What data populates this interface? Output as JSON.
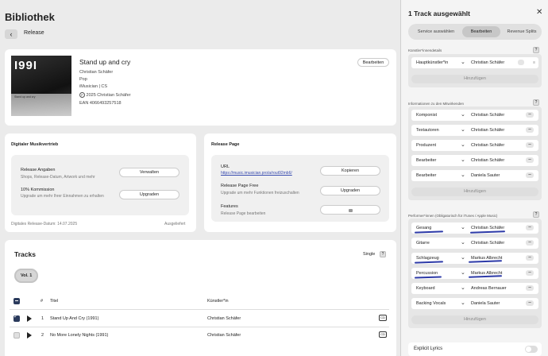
{
  "page": {
    "title": "Bibliothek",
    "breadcrumb": "Release"
  },
  "release": {
    "cover_text": "I99I",
    "cover_caption": "Stand up and cry",
    "name": "Stand up and cry",
    "artist": "Christian Schäfer",
    "genre": "Pop",
    "label_line": "iMusician | CS",
    "copyright": "2025 Christian Schäfer",
    "ean": "EAN 4066493257518",
    "edit_button": "Bearbeiten"
  },
  "distribution": {
    "title": "Digitaler Musikvertrieb",
    "release_info_title": "Release Angaben",
    "release_info_sub": "Shops, Release-Datum, Artwork und mehr",
    "manage_button": "Verwalten",
    "commission_title": "10% Kommission",
    "commission_sub": "Upgrade um mehr Ihrer Einnahmen zu erhalten",
    "upgrade_button": "Upgraden",
    "date_label": "Digitales Release-Datum: 14.07.2025",
    "status": "Ausgeliefert"
  },
  "release_page": {
    "title": "Release Page",
    "url_label": "URL",
    "url": "https://music.imusician.pro/a/rout92mb6/",
    "copy_button": "Kopieren",
    "free_title": "Release Page Free",
    "free_sub": "Upgrade um mehr Funktionen freizuschalten",
    "upgrade_button": "Upgraden",
    "features_title": "Features",
    "features_sub": "Release Page bearbeiten"
  },
  "tracks": {
    "title": "Tracks",
    "mode": "Single",
    "volume": "Vol. 1",
    "col_number": "#",
    "col_title": "Titel",
    "col_artist": "Künstler*in",
    "rows": [
      {
        "number": "1",
        "title": "Stand Up And Cry (1991)",
        "artist": "Christian Schäfer",
        "checked": true
      },
      {
        "number": "2",
        "title": "No More Lonely Nights (1991)",
        "artist": "Christian Schäfer",
        "checked": false
      }
    ]
  },
  "panel": {
    "title": "1 Track ausgewählt",
    "tabs": [
      "Service auswählen",
      "Bearbeiten",
      "Revenue Splits"
    ],
    "active_tab": "Bearbeiten",
    "main_artists_label": "Künstler*innendetails",
    "main_artists": [
      {
        "role": "Hauptkünstler*in",
        "name": "Christian Schäfer"
      }
    ],
    "add_label": "Hinzufügen",
    "contributors_label": "Informationen zu den Mitwirkenden",
    "contributors": [
      {
        "role": "Komponist",
        "name": "Christian Schäfer"
      },
      {
        "role": "Textautoren",
        "name": "Christian Schäfer"
      },
      {
        "role": "Produzent",
        "name": "Christian Schäfer"
      },
      {
        "role": "Bearbeiter",
        "name": "Christian Schäfer"
      },
      {
        "role": "Bearbeiter",
        "name": "Daniela Sauter"
      }
    ],
    "performers_label": "Performer*innen (Obligatorisch für iTunes / Apple Music)",
    "performers": [
      {
        "role": "Gesang",
        "name": "Christian Schäfer"
      },
      {
        "role": "Gitarre",
        "name": "Christian Schäfer"
      },
      {
        "role": "Schlagzeug",
        "name": "Markus Albrecht"
      },
      {
        "role": "Percussion",
        "name": "Markus Albrecht"
      },
      {
        "role": "Keyboard",
        "name": "Andreas Bernauer"
      },
      {
        "role": "Backing Vocals",
        "name": "Daniela Sauter"
      }
    ],
    "explicit_label": "Explicit Lyrics"
  }
}
